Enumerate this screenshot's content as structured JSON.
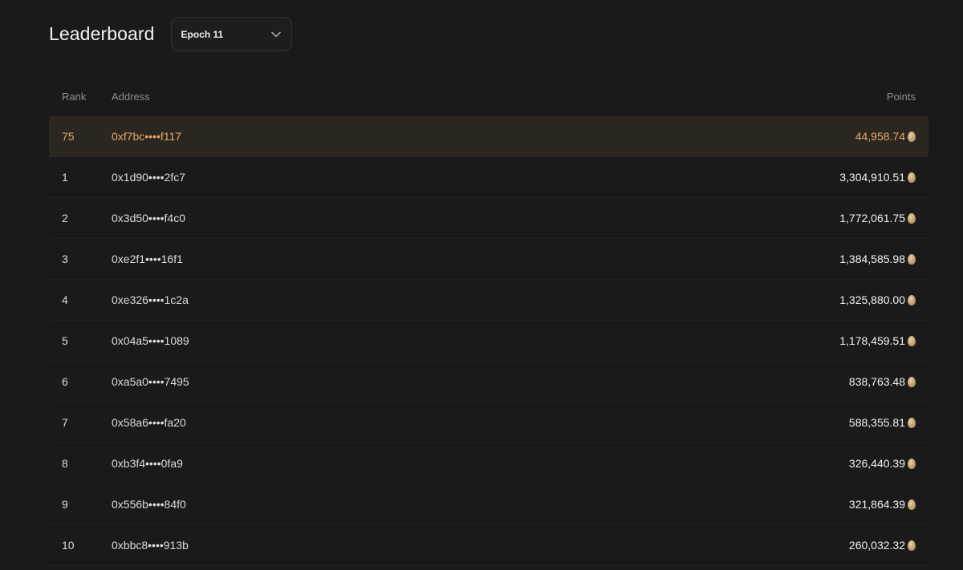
{
  "header": {
    "title": "Leaderboard",
    "epoch_select": {
      "selected": "Epoch 11"
    }
  },
  "table": {
    "columns": {
      "rank": "Rank",
      "address": "Address",
      "points": "Points"
    },
    "self_row": {
      "rank": "75",
      "address": "0xf7bc••••f117",
      "points": "44,958.74"
    },
    "rows": [
      {
        "rank": "1",
        "address": "0x1d90••••2fc7",
        "points": "3,304,910.51"
      },
      {
        "rank": "2",
        "address": "0x3d50••••f4c0",
        "points": "1,772,061.75"
      },
      {
        "rank": "3",
        "address": "0xe2f1••••16f1",
        "points": "1,384,585.98"
      },
      {
        "rank": "4",
        "address": "0xe326••••1c2a",
        "points": "1,325,880.00"
      },
      {
        "rank": "5",
        "address": "0x04a5••••1089",
        "points": "1,178,459.51"
      },
      {
        "rank": "6",
        "address": "0xa5a0••••7495",
        "points": "838,763.48"
      },
      {
        "rank": "7",
        "address": "0x58a6••••fa20",
        "points": "588,355.81"
      },
      {
        "rank": "8",
        "address": "0xb3f4••••0fa9",
        "points": "326,440.39"
      },
      {
        "rank": "9",
        "address": "0x556b••••84f0",
        "points": "321,864.39"
      },
      {
        "rank": "10",
        "address": "0xbbc8••••913b",
        "points": "260,032.32"
      }
    ]
  },
  "icons": {
    "points_unit": "egg-icon",
    "dropdown": "chevron-down-icon"
  },
  "colors": {
    "background": "#1a1a1a",
    "highlight_row": "#2b2620",
    "highlight_text": "#e7a86a"
  }
}
